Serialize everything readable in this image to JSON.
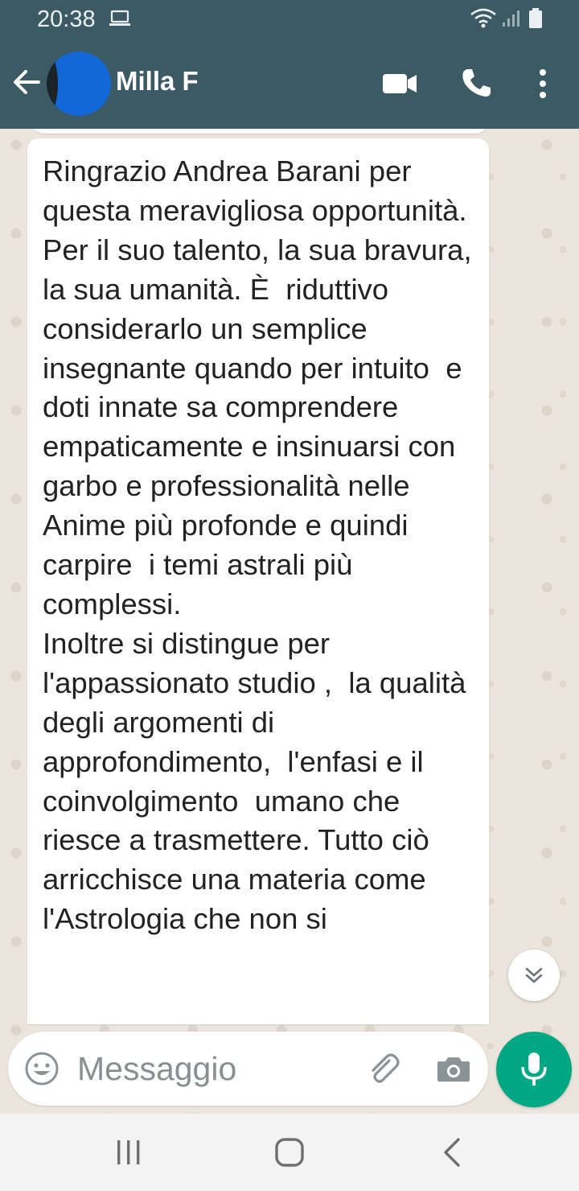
{
  "status_bar": {
    "time": "20:38",
    "icons": [
      "laptop-icon",
      "wifi-icon",
      "signal-icon",
      "battery-icon"
    ]
  },
  "header": {
    "contact_name": "Milla F",
    "icons": [
      "back-arrow-icon",
      "avatar",
      "video-call-icon",
      "phone-icon",
      "more-vert-icon"
    ]
  },
  "message": {
    "text": "Ringrazio Andrea Barani per questa meravigliosa opportunità.  Per il suo talento, la sua bravura,  la sua umanità. È  riduttivo considerarlo un semplice insegnante quando per intuito  e doti innate sa comprendere empaticamente e insinuarsi con garbo e professionalità nelle Anime più profonde e quindi carpire  i temi astrali più complessi.\nInoltre si distingue per l'appassionato studio ,  la qualità degli argomenti di approfondimento,  l'enfasi e il coinvolgimento  umano che riesce a trasmettere. Tutto ciò arricchisce una materia come  l'Astrologia che non si"
  },
  "input": {
    "placeholder": "Messaggio",
    "value": ""
  },
  "colors": {
    "header_bg": "#3c5a64",
    "chat_bg": "#ece5dd",
    "mic_button": "#00a884",
    "bubble_bg": "#ffffff"
  }
}
